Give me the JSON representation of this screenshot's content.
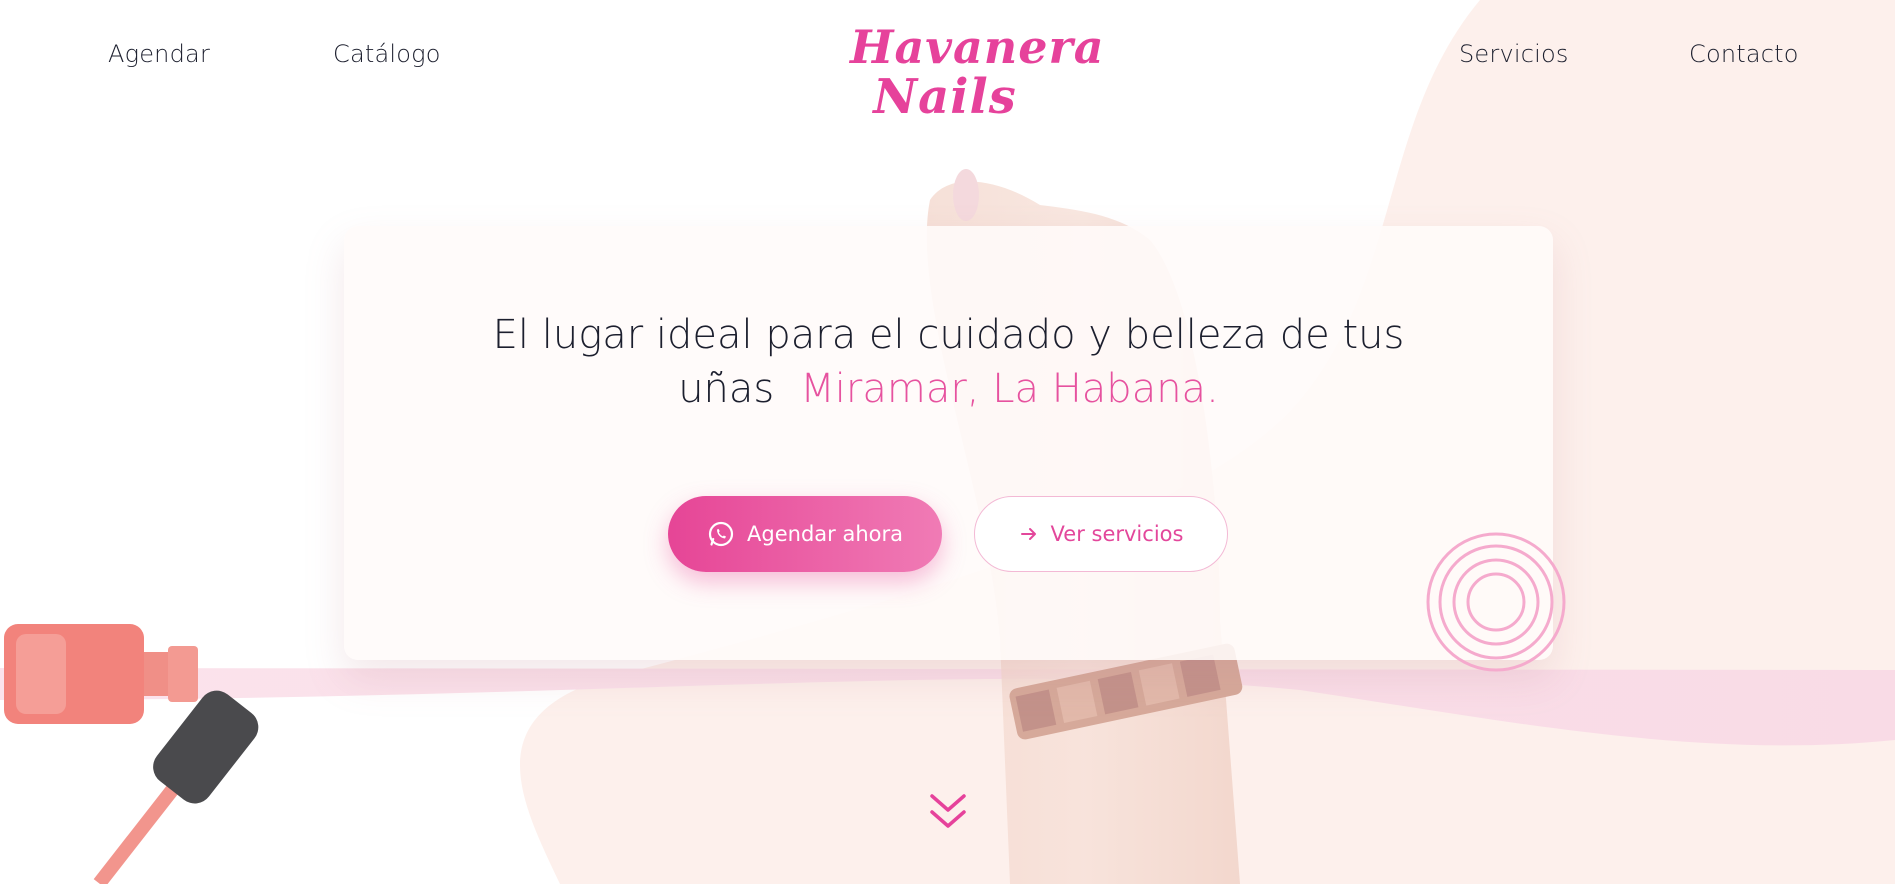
{
  "nav": {
    "left": [
      "Agendar",
      "Catálogo"
    ],
    "right": [
      "Servicios",
      "Contacto"
    ]
  },
  "logo": {
    "line1": "Havanera",
    "line2": "Nails"
  },
  "hero": {
    "headline_line1": "El lugar ideal para el cuidado y belleza de tus",
    "headline_line2": "uñas",
    "location": "Miramar, La Habana."
  },
  "buttons": {
    "primary": "Agendar ahora",
    "primary_icon": "whatsapp-icon",
    "secondary": "Ver servicios",
    "secondary_icon": "arrow-right-icon"
  },
  "colors": {
    "brand_pink": "#e6429b",
    "text_dark": "#1c1f2e",
    "button_gradient_start": "#e64596",
    "button_gradient_end": "#f07bb5"
  },
  "scroll_icon": "double-chevron-down-icon"
}
